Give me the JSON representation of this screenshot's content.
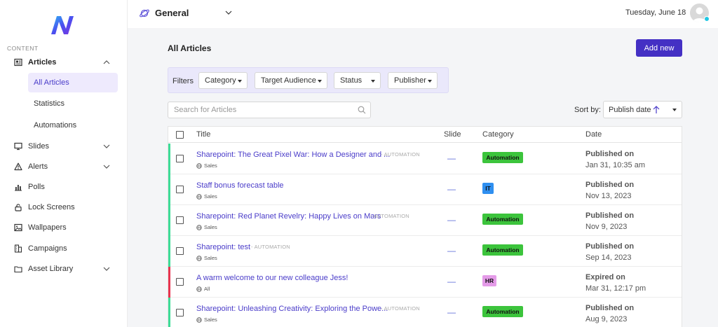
{
  "sidebar": {
    "section_label": "CONTENT",
    "items": [
      {
        "label": "Articles",
        "icon": "newspaper-icon"
      },
      {
        "label": "Slides",
        "icon": "monitor-icon"
      },
      {
        "label": "Alerts",
        "icon": "warning-icon"
      },
      {
        "label": "Polls",
        "icon": "bar-chart-icon"
      },
      {
        "label": "Lock Screens",
        "icon": "lock-icon"
      },
      {
        "label": "Wallpapers",
        "icon": "image-icon"
      },
      {
        "label": "Campaigns",
        "icon": "building-icon"
      },
      {
        "label": "Asset Library",
        "icon": "folder-icon"
      }
    ],
    "sub_items": [
      {
        "label": "All Articles",
        "active": true
      },
      {
        "label": "Statistics",
        "active": false
      },
      {
        "label": "Automations",
        "active": false
      }
    ]
  },
  "header": {
    "workspace": "General",
    "date": "Tuesday, June 18"
  },
  "main": {
    "title": "All Articles",
    "add_button": "Add new",
    "filters": {
      "label": "Filters",
      "buttons": [
        "Category",
        "Target Audience",
        "Status",
        "Publisher"
      ]
    },
    "search": {
      "placeholder": "Search for Articles"
    },
    "sort": {
      "label": "Sort by:",
      "value": "Publish date"
    },
    "table": {
      "columns": [
        "Title",
        "Slide",
        "Category",
        "Date"
      ],
      "rows": [
        {
          "title": "Sharepoint: The Great Pixel War: How a Designer and ...",
          "tag": "- AUTOMATION",
          "audience": "Sales",
          "slide": "—",
          "category": "Automation",
          "status": "Published on",
          "date": "Jan 31, 10:35 am",
          "bar_color": "#3ddc97",
          "badge_color": "#3cc43c"
        },
        {
          "title": "Staff bonus forecast table",
          "tag": "",
          "audience": "Sales",
          "slide": "—",
          "category": "IT",
          "status": "Published on",
          "date": "Nov 13, 2023",
          "bar_color": "#3ddc97",
          "badge_color": "#2f8ff0"
        },
        {
          "title": "Sharepoint: Red Planet Revelry: Happy Lives on Mars",
          "tag": "- AUTOMATION",
          "audience": "Sales",
          "slide": "—",
          "category": "Automation",
          "status": "Published on",
          "date": "Nov 9, 2023",
          "bar_color": "#3ddc97",
          "badge_color": "#3cc43c"
        },
        {
          "title": "Sharepoint: test",
          "tag": "- AUTOMATION",
          "audience": "Sales",
          "slide": "—",
          "category": "Automation",
          "status": "Published on",
          "date": "Sep 14, 2023",
          "bar_color": "#3ddc97",
          "badge_color": "#3cc43c"
        },
        {
          "title": "A warm welcome to our new colleague Jess!",
          "tag": "",
          "audience": "All",
          "slide": "—",
          "category": "HR",
          "status": "Expired on",
          "date": "Mar 31, 12:17 pm",
          "bar_color": "#e8344f",
          "badge_color": "#e49be8"
        },
        {
          "title": "Sharepoint: Unleashing Creativity: Exploring the Powe...",
          "tag": "- AUTOMATION",
          "audience": "Sales",
          "slide": "—",
          "category": "Automation",
          "status": "Published on",
          "date": "Aug 9, 2023",
          "bar_color": "#3ddc97",
          "badge_color": "#3cc43c"
        }
      ]
    }
  },
  "colors": {
    "accent": "#4430c4",
    "link": "#4a3cc9"
  }
}
